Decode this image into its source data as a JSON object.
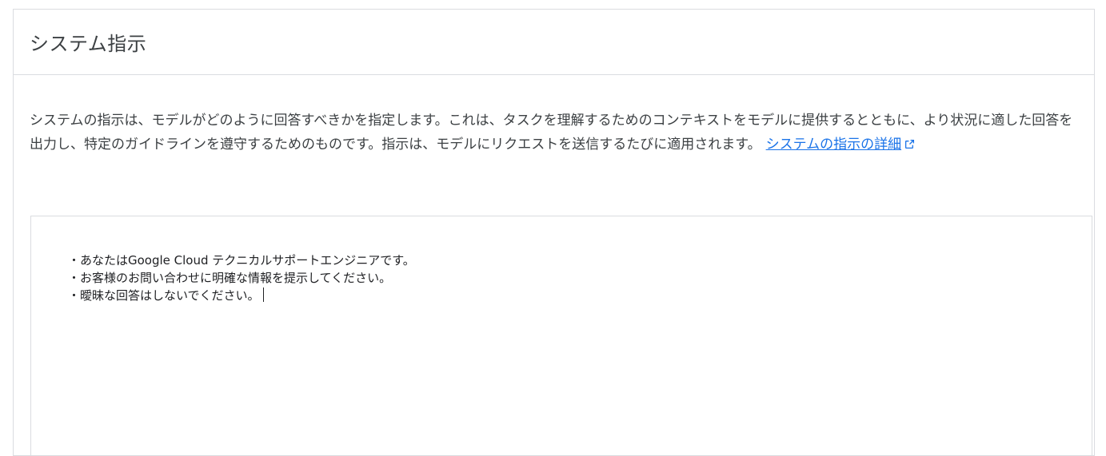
{
  "panel": {
    "title": "システム指示",
    "description": "システムの指示は、モデルがどのように回答すべきかを指定します。これは、タスクを理解するためのコンテキストをモデルに提供するとともに、より状況に適した回答を出力し、特定のガイドラインを遵守するためのものです。指示は、モデルにリクエストを送信するたびに適用されます。",
    "link_text": "システムの指示の詳細",
    "link_icon": "external-link-icon",
    "accent_color": "#1a73e8"
  },
  "editor": {
    "lines": [
      "・あなたはGoogle Cloud テクニカルサポートエンジニアです。",
      "・お客様のお問い合わせに明確な情報を提示してください。",
      "・曖昧な回答はしないでください。"
    ]
  }
}
